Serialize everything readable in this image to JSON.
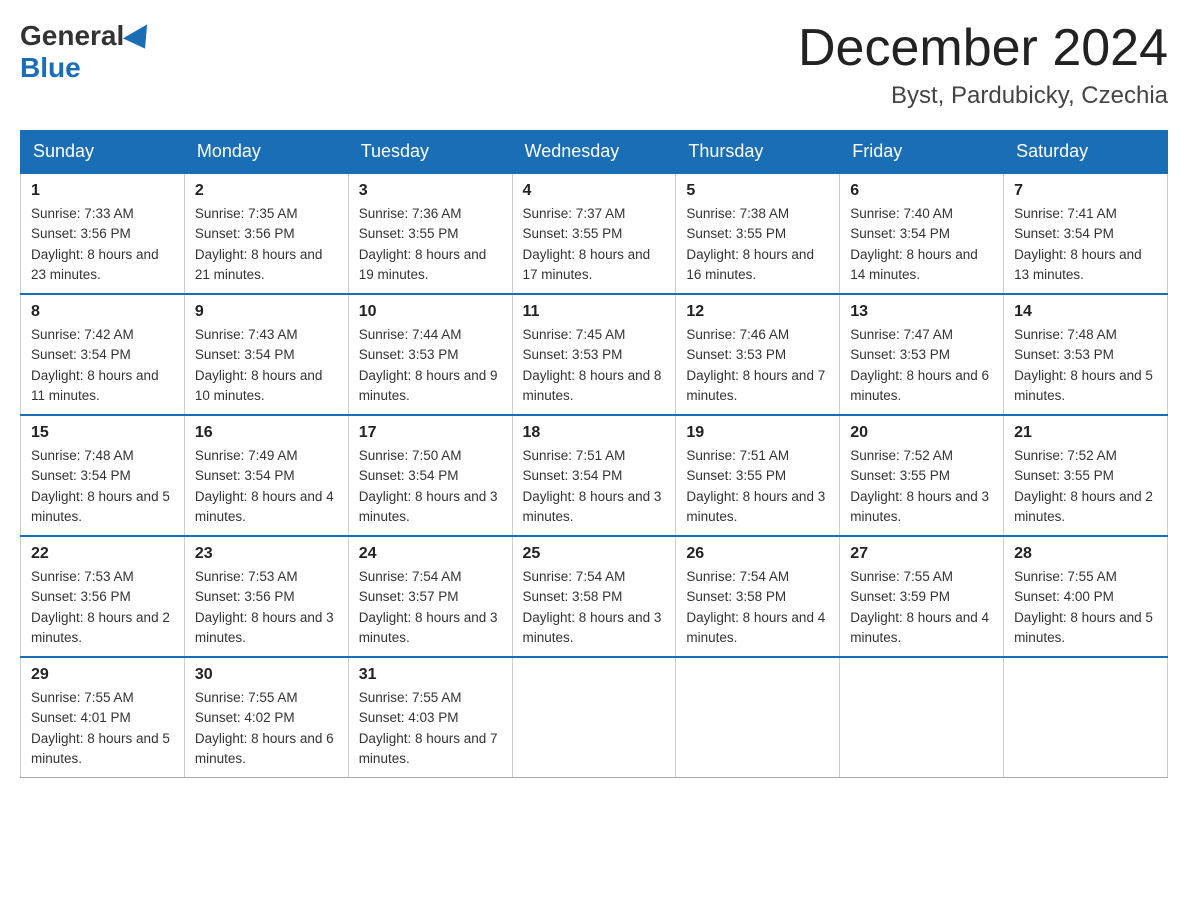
{
  "header": {
    "logo_general": "General",
    "logo_blue": "Blue",
    "month_title": "December 2024",
    "location": "Byst, Pardubicky, Czechia"
  },
  "days_of_week": [
    "Sunday",
    "Monday",
    "Tuesday",
    "Wednesday",
    "Thursday",
    "Friday",
    "Saturday"
  ],
  "weeks": [
    [
      {
        "day": "1",
        "sunrise": "7:33 AM",
        "sunset": "3:56 PM",
        "daylight": "8 hours and 23 minutes."
      },
      {
        "day": "2",
        "sunrise": "7:35 AM",
        "sunset": "3:56 PM",
        "daylight": "8 hours and 21 minutes."
      },
      {
        "day": "3",
        "sunrise": "7:36 AM",
        "sunset": "3:55 PM",
        "daylight": "8 hours and 19 minutes."
      },
      {
        "day": "4",
        "sunrise": "7:37 AM",
        "sunset": "3:55 PM",
        "daylight": "8 hours and 17 minutes."
      },
      {
        "day": "5",
        "sunrise": "7:38 AM",
        "sunset": "3:55 PM",
        "daylight": "8 hours and 16 minutes."
      },
      {
        "day": "6",
        "sunrise": "7:40 AM",
        "sunset": "3:54 PM",
        "daylight": "8 hours and 14 minutes."
      },
      {
        "day": "7",
        "sunrise": "7:41 AM",
        "sunset": "3:54 PM",
        "daylight": "8 hours and 13 minutes."
      }
    ],
    [
      {
        "day": "8",
        "sunrise": "7:42 AM",
        "sunset": "3:54 PM",
        "daylight": "8 hours and 11 minutes."
      },
      {
        "day": "9",
        "sunrise": "7:43 AM",
        "sunset": "3:54 PM",
        "daylight": "8 hours and 10 minutes."
      },
      {
        "day": "10",
        "sunrise": "7:44 AM",
        "sunset": "3:53 PM",
        "daylight": "8 hours and 9 minutes."
      },
      {
        "day": "11",
        "sunrise": "7:45 AM",
        "sunset": "3:53 PM",
        "daylight": "8 hours and 8 minutes."
      },
      {
        "day": "12",
        "sunrise": "7:46 AM",
        "sunset": "3:53 PM",
        "daylight": "8 hours and 7 minutes."
      },
      {
        "day": "13",
        "sunrise": "7:47 AM",
        "sunset": "3:53 PM",
        "daylight": "8 hours and 6 minutes."
      },
      {
        "day": "14",
        "sunrise": "7:48 AM",
        "sunset": "3:53 PM",
        "daylight": "8 hours and 5 minutes."
      }
    ],
    [
      {
        "day": "15",
        "sunrise": "7:48 AM",
        "sunset": "3:54 PM",
        "daylight": "8 hours and 5 minutes."
      },
      {
        "day": "16",
        "sunrise": "7:49 AM",
        "sunset": "3:54 PM",
        "daylight": "8 hours and 4 minutes."
      },
      {
        "day": "17",
        "sunrise": "7:50 AM",
        "sunset": "3:54 PM",
        "daylight": "8 hours and 3 minutes."
      },
      {
        "day": "18",
        "sunrise": "7:51 AM",
        "sunset": "3:54 PM",
        "daylight": "8 hours and 3 minutes."
      },
      {
        "day": "19",
        "sunrise": "7:51 AM",
        "sunset": "3:55 PM",
        "daylight": "8 hours and 3 minutes."
      },
      {
        "day": "20",
        "sunrise": "7:52 AM",
        "sunset": "3:55 PM",
        "daylight": "8 hours and 3 minutes."
      },
      {
        "day": "21",
        "sunrise": "7:52 AM",
        "sunset": "3:55 PM",
        "daylight": "8 hours and 2 minutes."
      }
    ],
    [
      {
        "day": "22",
        "sunrise": "7:53 AM",
        "sunset": "3:56 PM",
        "daylight": "8 hours and 2 minutes."
      },
      {
        "day": "23",
        "sunrise": "7:53 AM",
        "sunset": "3:56 PM",
        "daylight": "8 hours and 3 minutes."
      },
      {
        "day": "24",
        "sunrise": "7:54 AM",
        "sunset": "3:57 PM",
        "daylight": "8 hours and 3 minutes."
      },
      {
        "day": "25",
        "sunrise": "7:54 AM",
        "sunset": "3:58 PM",
        "daylight": "8 hours and 3 minutes."
      },
      {
        "day": "26",
        "sunrise": "7:54 AM",
        "sunset": "3:58 PM",
        "daylight": "8 hours and 4 minutes."
      },
      {
        "day": "27",
        "sunrise": "7:55 AM",
        "sunset": "3:59 PM",
        "daylight": "8 hours and 4 minutes."
      },
      {
        "day": "28",
        "sunrise": "7:55 AM",
        "sunset": "4:00 PM",
        "daylight": "8 hours and 5 minutes."
      }
    ],
    [
      {
        "day": "29",
        "sunrise": "7:55 AM",
        "sunset": "4:01 PM",
        "daylight": "8 hours and 5 minutes."
      },
      {
        "day": "30",
        "sunrise": "7:55 AM",
        "sunset": "4:02 PM",
        "daylight": "8 hours and 6 minutes."
      },
      {
        "day": "31",
        "sunrise": "7:55 AM",
        "sunset": "4:03 PM",
        "daylight": "8 hours and 7 minutes."
      },
      null,
      null,
      null,
      null
    ]
  ],
  "labels": {
    "sunrise": "Sunrise:",
    "sunset": "Sunset:",
    "daylight": "Daylight:"
  }
}
